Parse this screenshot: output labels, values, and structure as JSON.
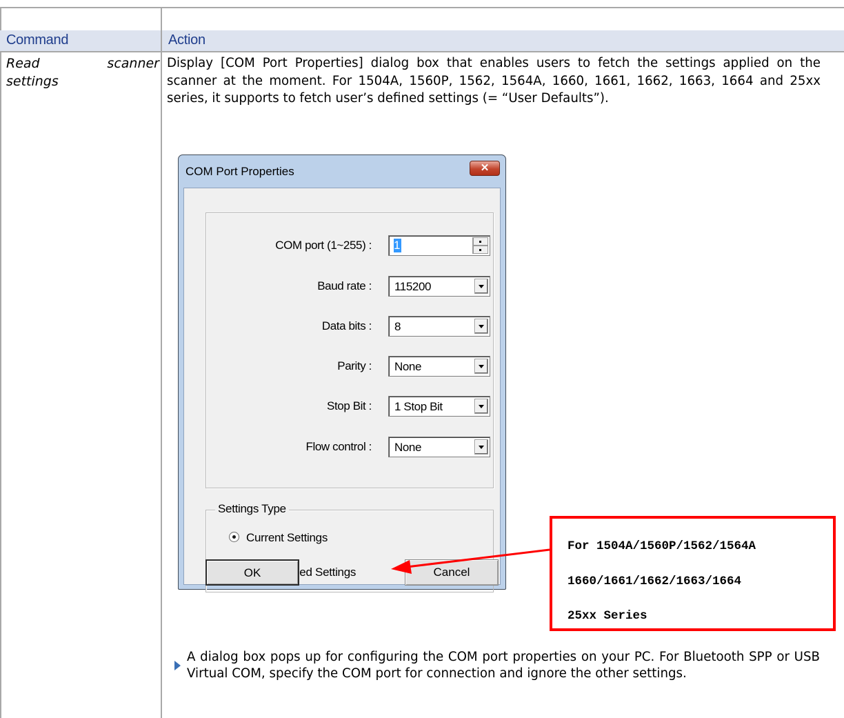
{
  "table": {
    "header": {
      "command": "Command",
      "action": "Action"
    },
    "row": {
      "command_line1_a": "Read",
      "command_line1_b": "scanner",
      "command_line2": "settings",
      "action_text": "Display [COM Port Properties] dialog box that enables users to fetch the settings applied on the scanner at the moment. For 1504A, 1560P, 1562, 1564A, 1660, 1661, 1662, 1663, 1664 and 25xx series, it supports to fetch user’s defined settings (= “User Defaults”).",
      "bullet_text": "A dialog box pops up for configuring the COM port properties on your PC. For Bluetooth SPP or USB Virtual COM, specify the COM port for connection and ignore the other settings."
    }
  },
  "dialog": {
    "title": "COM Port Properties",
    "close_glyph": "✕",
    "fields": {
      "com_port": {
        "label": "COM port (1~255) :",
        "value": "1"
      },
      "baud_rate": {
        "label": "Baud rate :",
        "value": "115200"
      },
      "data_bits": {
        "label": "Data bits :",
        "value": "8"
      },
      "parity": {
        "label": "Parity :",
        "value": "None"
      },
      "stop_bit": {
        "label": "Stop Bit :",
        "value": "1 Stop Bit"
      },
      "flow_control": {
        "label": "Flow control :",
        "value": "None"
      }
    },
    "settings_type": {
      "legend": "Settings Type",
      "current": "Current Settings",
      "user_defined": "User Defined Settings",
      "selected": "current"
    },
    "buttons": {
      "ok": "OK",
      "cancel": "Cancel"
    }
  },
  "callout": {
    "line1": "For 1504A/1560P/1562/1564A",
    "line2": "1660/1661/1662/1663/1664",
    "line3": "25xx Series",
    "color": "#ff0000"
  }
}
